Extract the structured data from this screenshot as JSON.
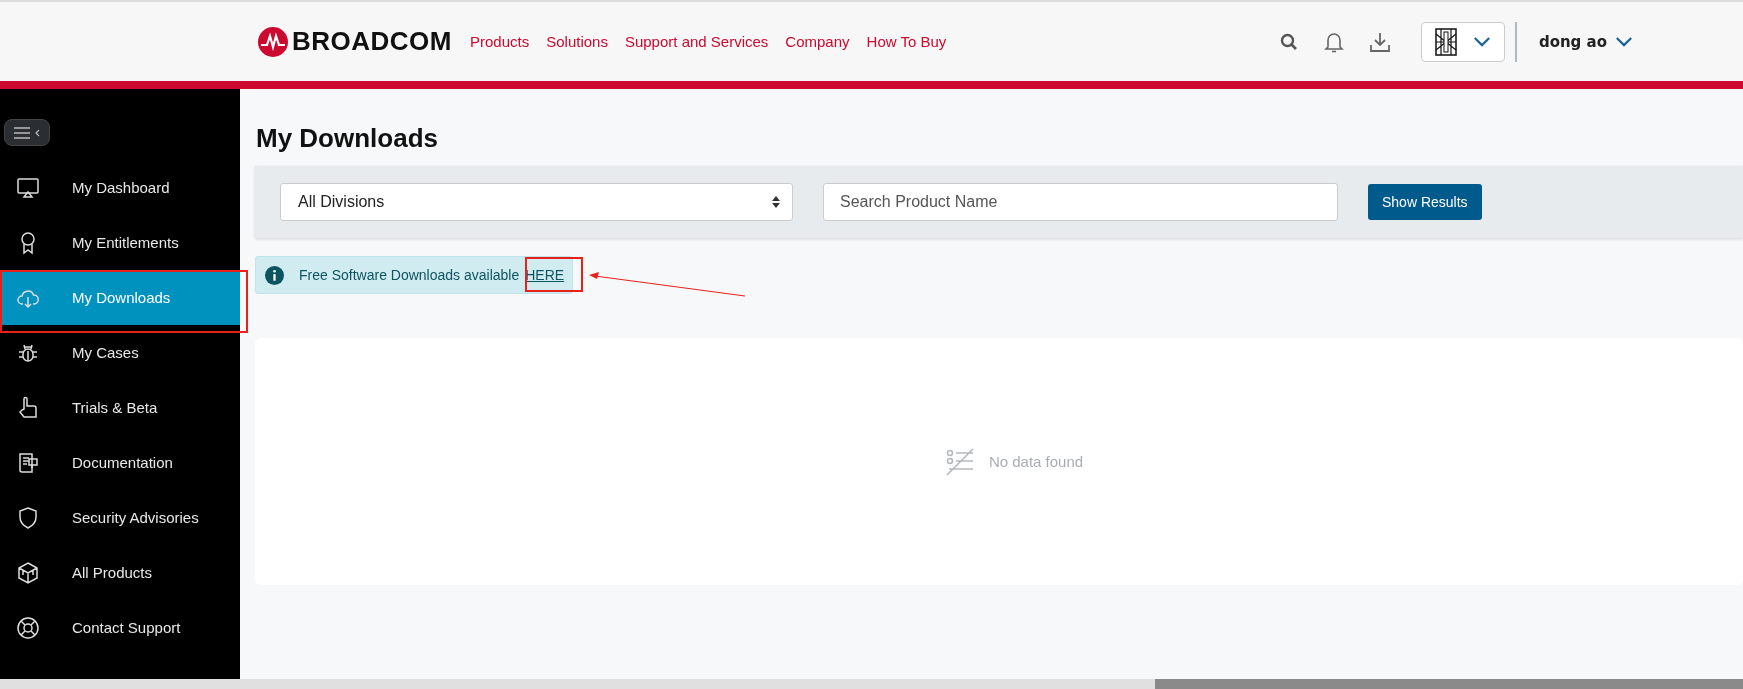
{
  "header": {
    "logo": "BROADCOM",
    "nav": [
      "Products",
      "Solutions",
      "Support and Services",
      "Company",
      "How To Buy"
    ],
    "user": "dong ao"
  },
  "sidebar": {
    "items": [
      {
        "label": "My Dashboard",
        "selected": false
      },
      {
        "label": "My Entitlements",
        "selected": false
      },
      {
        "label": "My Downloads",
        "selected": true
      },
      {
        "label": "My Cases",
        "selected": false
      },
      {
        "label": "Trials & Beta",
        "selected": false
      },
      {
        "label": "Documentation",
        "selected": false
      },
      {
        "label": "Security Advisories",
        "selected": false
      },
      {
        "label": "All Products",
        "selected": false
      },
      {
        "label": "Contact Support",
        "selected": false
      }
    ]
  },
  "page": {
    "title": "My Downloads",
    "filters": {
      "division": "All Divisions",
      "search_placeholder": "Search Product Name",
      "button": "Show Results"
    },
    "alert": {
      "text": "Free Software Downloads available",
      "link": "HERE"
    },
    "empty_message": "No data found"
  }
}
